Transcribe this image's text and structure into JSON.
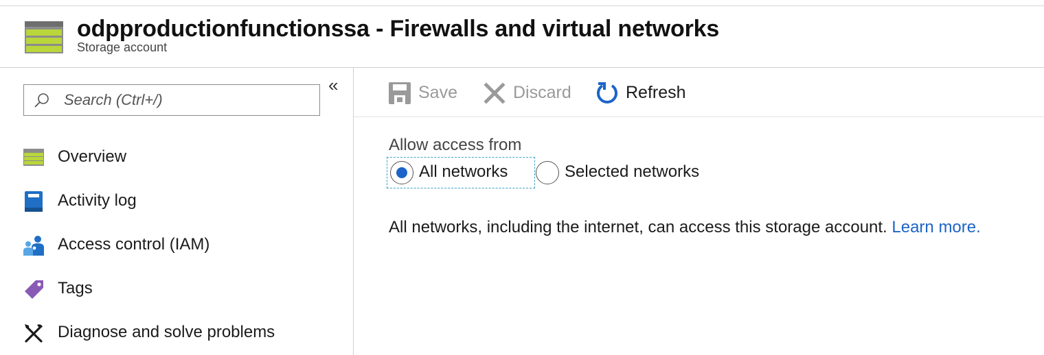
{
  "header": {
    "title": "odpproductionfunctionssa - Firewalls and virtual networks",
    "subtitle": "Storage account",
    "icon": "storage-account-icon"
  },
  "sidebar": {
    "search": {
      "placeholder": "Search (Ctrl+/)",
      "value": ""
    },
    "collapse_glyph": "«",
    "items": [
      {
        "label": "Overview",
        "icon": "overview-icon"
      },
      {
        "label": "Activity log",
        "icon": "book-icon"
      },
      {
        "label": "Access control (IAM)",
        "icon": "people-icon"
      },
      {
        "label": "Tags",
        "icon": "tag-icon"
      },
      {
        "label": "Diagnose and solve problems",
        "icon": "wrench-icon"
      }
    ]
  },
  "toolbar": {
    "save_label": "Save",
    "discard_label": "Discard",
    "refresh_label": "Refresh"
  },
  "main": {
    "allow_access_label": "Allow access from",
    "options": [
      {
        "label": "All networks",
        "selected": true
      },
      {
        "label": "Selected networks",
        "selected": false
      }
    ],
    "info_text": "All networks, including the internet, can access this storage account.",
    "learn_more": "Learn more."
  },
  "colors": {
    "accent": "#1c64c8",
    "disabled": "#9a9a9a",
    "storage_green": "#b7d43a",
    "storage_gray": "#7a7a7a",
    "tag_purple": "#8a5bb5"
  }
}
